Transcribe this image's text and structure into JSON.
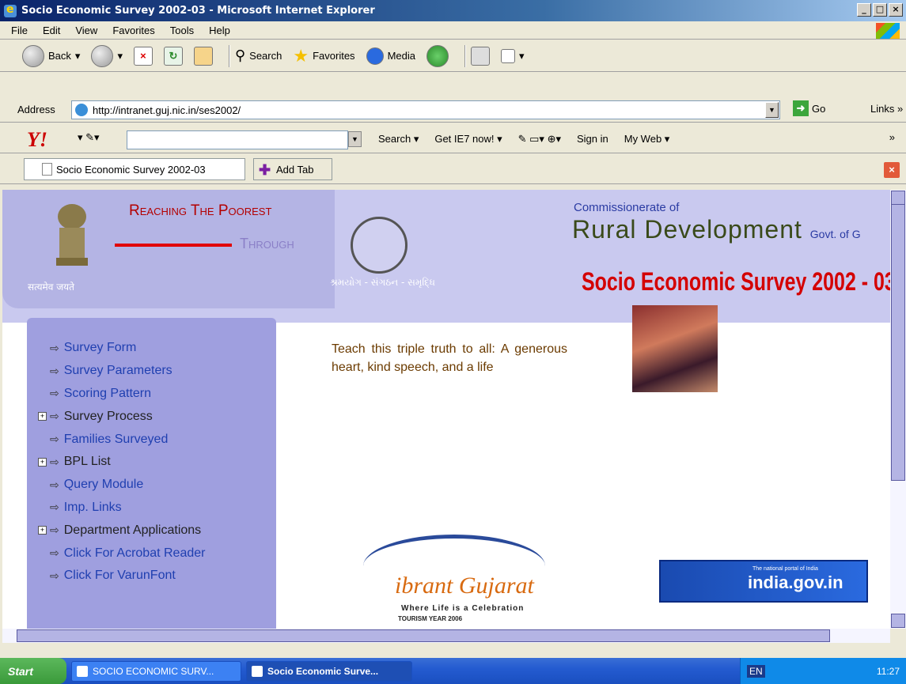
{
  "window": {
    "title": "Socio Economic Survey 2002-03 - Microsoft Internet Explorer"
  },
  "menu": [
    "File",
    "Edit",
    "View",
    "Favorites",
    "Tools",
    "Help"
  ],
  "toolbar": {
    "back": "Back",
    "search": "Search",
    "favorites": "Favorites",
    "media": "Media"
  },
  "address": {
    "label": "Address",
    "url": "http://intranet.guj.nic.in/ses2002/",
    "go": "Go",
    "links": "Links"
  },
  "yahoo": {
    "search": "Search",
    "ie7": "Get IE7 now!",
    "signin": "Sign in",
    "myweb": "My Web"
  },
  "tabs": {
    "active": "Socio Economic Survey 2002-03",
    "add": "Add Tab"
  },
  "header": {
    "reaching": "Reaching The Poorest",
    "through": "Through",
    "satyamev": "सत्यमेव जयते",
    "guj_tagline": "શ્રમયોગ - સંગઠન - સમૃદ્ધિ",
    "commissionerate": "Commissionerate of",
    "rural": "Rural Development",
    "govt": "Govt. of G",
    "ses_title": "Socio Economic Survey 2002 - 03"
  },
  "nav": [
    {
      "label": "Survey Form",
      "expand": false,
      "color": "link"
    },
    {
      "label": "Survey Parameters",
      "expand": false,
      "color": "link"
    },
    {
      "label": "Scoring Pattern",
      "expand": false,
      "color": "link"
    },
    {
      "label": "Survey Process",
      "expand": true,
      "color": "dark"
    },
    {
      "label": "Families Surveyed",
      "expand": false,
      "color": "link"
    },
    {
      "label": "BPL List",
      "expand": true,
      "color": "dark"
    },
    {
      "label": "Query Module",
      "expand": false,
      "color": "link"
    },
    {
      "label": "Imp. Links",
      "expand": false,
      "color": "link"
    },
    {
      "label": "Department Applications",
      "expand": true,
      "color": "dark"
    },
    {
      "label": "Click For Acrobat Reader",
      "expand": false,
      "color": "link"
    },
    {
      "label": "Click For VarunFont",
      "expand": false,
      "color": "link"
    }
  ],
  "quote": "Teach this triple truth to all: A generous heart, kind speech, and a life",
  "vibrant": {
    "title": "ibrant Gujarat",
    "sub": "Where Life is a Celebration",
    "tourism": "TOURISM YEAR 2006"
  },
  "india": {
    "small": "The national portal of India",
    "big": "india.gov.in"
  },
  "taskbar": {
    "start": "Start",
    "task1": "SOCIO ECONOMIC SURV...",
    "task2": "Socio Economic Surve...",
    "lang": "EN",
    "time": "11:27"
  }
}
